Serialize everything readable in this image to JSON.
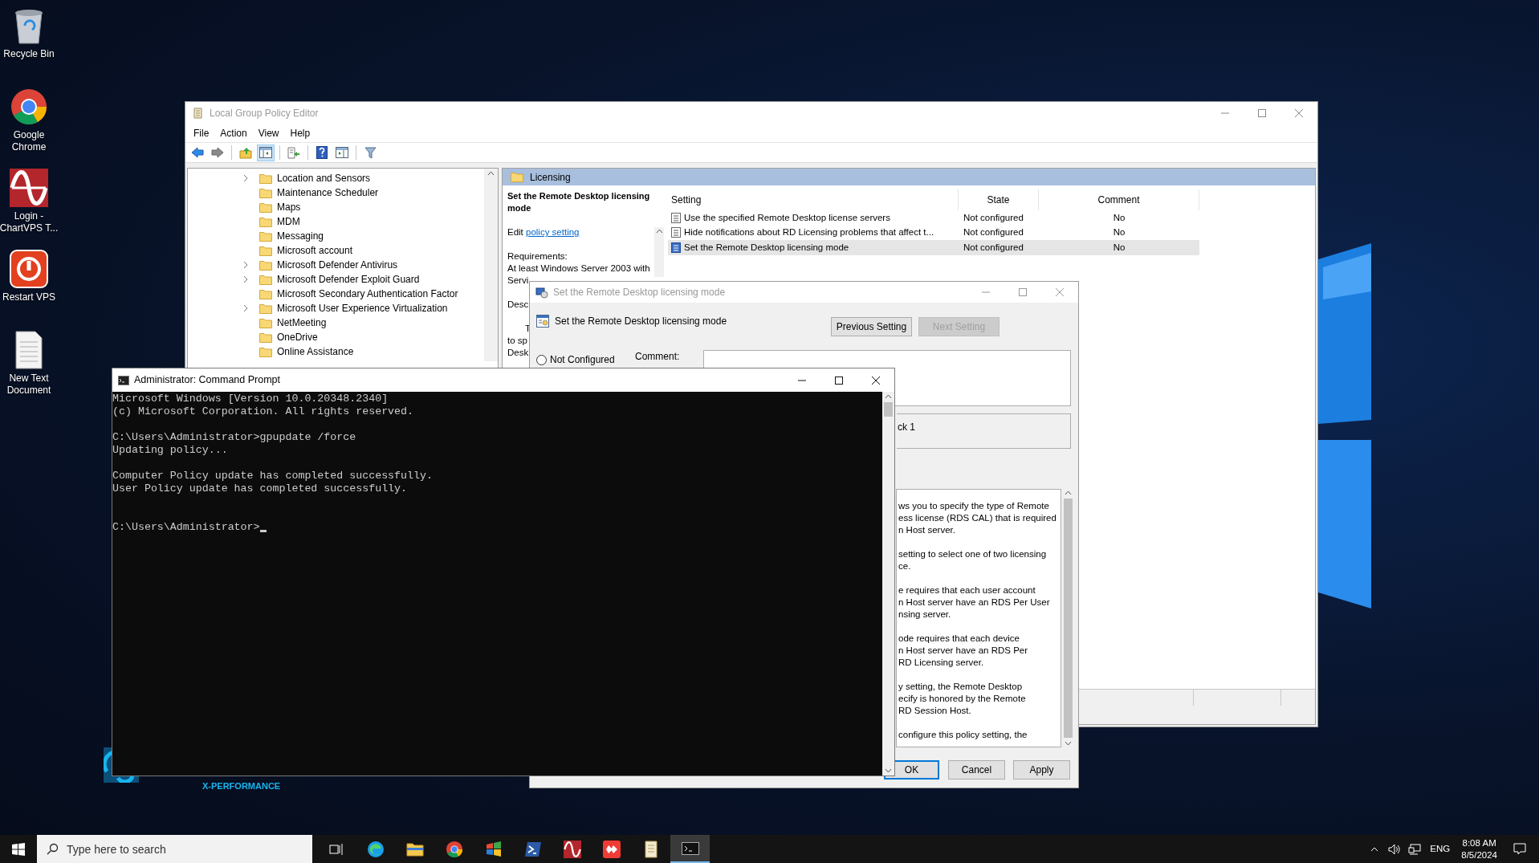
{
  "desktop_icons": [
    {
      "label": "Recycle Bin",
      "kind": "recycle"
    },
    {
      "label": "Google Chrome",
      "kind": "chrome"
    },
    {
      "label": "Login - ChartVPS T...",
      "kind": "wave"
    },
    {
      "label": "Restart VPS",
      "kind": "power"
    },
    {
      "label": "New Text Document",
      "kind": "textfile"
    }
  ],
  "wallpaper_brand": {
    "text": "X-PERFORMANCE"
  },
  "policy_editor": {
    "title": "Local Group Policy Editor",
    "menu": [
      "File",
      "Action",
      "View",
      "Help"
    ],
    "toolbar": [
      {
        "kind": "back",
        "pressed": false
      },
      {
        "kind": "forward",
        "pressed": false
      },
      {
        "kind": "up",
        "pressed": false
      },
      {
        "kind": "tree",
        "pressed": true
      },
      {
        "kind": "export",
        "pressed": false
      },
      {
        "kind": "help",
        "pressed": false
      },
      {
        "kind": "panel",
        "pressed": false
      },
      {
        "kind": "filter",
        "pressed": false
      }
    ],
    "tree": [
      {
        "label": "Location and Sensors",
        "has_children": true
      },
      {
        "label": "Maintenance Scheduler",
        "has_children": false
      },
      {
        "label": "Maps",
        "has_children": false
      },
      {
        "label": "MDM",
        "has_children": false
      },
      {
        "label": "Messaging",
        "has_children": false
      },
      {
        "label": "Microsoft account",
        "has_children": false
      },
      {
        "label": "Microsoft Defender Antivirus",
        "has_children": true
      },
      {
        "label": "Microsoft Defender Exploit Guard",
        "has_children": true
      },
      {
        "label": "Microsoft Secondary Authentication Factor",
        "has_children": false
      },
      {
        "label": "Microsoft User Experience Virtualization",
        "has_children": true
      },
      {
        "label": "NetMeeting",
        "has_children": false
      },
      {
        "label": "OneDrive",
        "has_children": false
      },
      {
        "label": "Online Assistance",
        "has_children": false
      }
    ],
    "pane_title": "Licensing",
    "description": {
      "heading": "Set the Remote Desktop licensing mode",
      "edit_prefix": "Edit",
      "edit_link": "policy setting",
      "paragraphs": [
        {
          "first_line_indent": false,
          "lines": [
            "Requirements:",
            "At least Windows Server 2003 with",
            "Servi"
          ]
        },
        {
          "first_line_indent": false,
          "lines": [
            "Desc"
          ]
        },
        {
          "first_line_indent": true,
          "lines": [
            "T",
            "to sp",
            "Desk"
          ]
        }
      ]
    },
    "columns": [
      "Setting",
      "State",
      "Comment"
    ],
    "rows": [
      {
        "setting": "Use the specified Remote Desktop license servers",
        "state": "Not configured",
        "comment": "No",
        "selected": false
      },
      {
        "setting": "Hide notifications about RD Licensing problems that affect t...",
        "state": "Not configured",
        "comment": "No",
        "selected": false
      },
      {
        "setting": "Set the Remote Desktop licensing mode",
        "state": "Not configured",
        "comment": "No",
        "selected": true
      }
    ]
  },
  "setting_dialog": {
    "title": "Set the Remote Desktop licensing mode",
    "header": "Set the Remote Desktop licensing mode",
    "nav_buttons": [
      {
        "label": "Previous Setting",
        "disabled": false
      },
      {
        "label": "Next Setting",
        "disabled": true
      }
    ],
    "radio": {
      "label": "Not Configured",
      "selected": false
    },
    "comment_label": "Comment:",
    "supported_text": "ck 1",
    "help": [
      [
        "ws you to specify the type of Remote",
        "ess license (RDS CAL) that is required",
        "n Host server."
      ],
      [
        "setting to select one of two licensing",
        "ce."
      ],
      [
        "e requires that each user account",
        "n Host server have an RDS Per User",
        "nsing server."
      ],
      [
        "ode requires that each device",
        "n Host server have an RDS Per",
        "RD Licensing server."
      ],
      [
        "y setting, the Remote Desktop",
        "ecify is honored by the Remote",
        "RD Session Host."
      ],
      [
        "configure this policy setting, the"
      ]
    ],
    "buttons": [
      {
        "label": "OK",
        "focused": true
      },
      {
        "label": "Cancel",
        "focused": false
      },
      {
        "label": "Apply",
        "focused": false
      }
    ]
  },
  "command_prompt": {
    "title": "Administrator: Command Prompt",
    "blocks": [
      [
        "Microsoft Windows [Version 10.0.20348.2340]",
        "(c) Microsoft Corporation. All rights reserved."
      ],
      [
        "C:\\Users\\Administrator>gpupdate /force",
        "Updating policy..."
      ],
      [
        "Computer Policy update has completed successfully.",
        "User Policy update has completed successfully."
      ]
    ],
    "prompt": "C:\\Users\\Administrator>"
  },
  "taskbar": {
    "search_placeholder": "Type here to search",
    "apps": [
      {
        "kind": "taskview",
        "selected": false
      },
      {
        "kind": "edge",
        "selected": false
      },
      {
        "kind": "folder",
        "selected": false
      },
      {
        "kind": "chrome",
        "selected": false
      },
      {
        "kind": "flag",
        "selected": false
      },
      {
        "kind": "shell",
        "selected": false
      },
      {
        "kind": "wave",
        "selected": false
      },
      {
        "kind": "remote",
        "selected": false
      },
      {
        "kind": "notepad",
        "selected": false
      },
      {
        "kind": "console",
        "selected": true
      }
    ],
    "language": "ENG",
    "time": "8:08 AM",
    "date": "8/5/2024"
  }
}
